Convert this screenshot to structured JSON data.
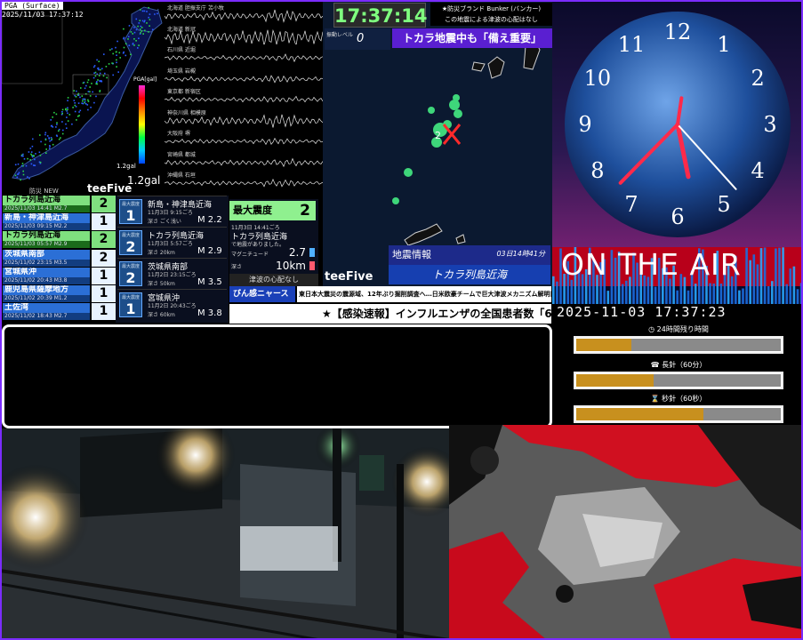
{
  "pga": {
    "header": "PGA (Surface)",
    "timestamp": "2025/11/03 17:37:12",
    "scale_label": "PGA[gal]",
    "gal_small": "1.2gal",
    "gal": "1.2gal",
    "new_label": "防災 NEW",
    "brand": "teeFive"
  },
  "waveforms": [
    {
      "label": "北海道 胆振支庁 苫小牧"
    },
    {
      "label": "北海道 新冠"
    },
    {
      "label": "石川県 近堀"
    },
    {
      "label": "埼玉県 岩槻"
    },
    {
      "label": "東京都 新宿区"
    },
    {
      "label": "神奈川県 相模原"
    },
    {
      "label": "大阪府 堺"
    },
    {
      "label": "宮崎県 都城"
    },
    {
      "label": "沖縄県 石垣"
    }
  ],
  "quakes": [
    {
      "place": "トカラ列島近海",
      "meta": "2025/11/03 14:41  M2.7",
      "intensity": "2"
    },
    {
      "place": "新島・神津島近海",
      "meta": "2025/11/03 09:15  M2.2",
      "intensity": "1"
    },
    {
      "place": "トカラ列島近海",
      "meta": "2025/11/03 05:57  M2.9",
      "intensity": "2"
    },
    {
      "place": "茨城県南部",
      "meta": "2025/11/02 23:15  M3.5",
      "intensity": "2"
    },
    {
      "place": "宮城県沖",
      "meta": "2025/11/02 20:43  M3.8",
      "intensity": "1"
    },
    {
      "place": "鹿児島県薩摩地方",
      "meta": "2025/11/02 20:39  M1.2",
      "intensity": "1"
    },
    {
      "place": "土佐湾",
      "meta": "2025/11/02 18:43  M2.7",
      "intensity": "1"
    }
  ],
  "details": [
    {
      "small": "最大震度",
      "int": "1",
      "place": "新島・神津島近海",
      "date": "11月3日 9:15ごろ",
      "depth": "深さ ごく浅い",
      "mag": "M 2.2"
    },
    {
      "small": "最大震度",
      "int": "2",
      "place": "トカラ列島近海",
      "date": "11月3日 5:57ごろ",
      "depth": "深さ 20km",
      "mag": "M 2.9"
    },
    {
      "small": "最大震度",
      "int": "2",
      "place": "茨城県南部",
      "date": "11月2日 23:15ごろ",
      "depth": "深さ 50km",
      "mag": "M 3.5"
    },
    {
      "small": "最大震度",
      "int": "1",
      "place": "宮城県沖",
      "date": "11月2日 20:43ごろ",
      "depth": "深さ 60km",
      "mag": "M 3.8"
    }
  ],
  "max_intensity": {
    "label": "最大震度",
    "value": "2",
    "time": "11月3日 14:41ごろ",
    "place": "トカラ列島近海",
    "line3": "で地震がありました。",
    "mag_label": "マグニチュード",
    "mag": "2.7",
    "depth_label": "深さ",
    "depth": "10km"
  },
  "tsunami": "津波の心配なし",
  "ticker1": {
    "label": "びん感ニャース",
    "text": "東日本大震災の震源域、12年ぶり掘削調査へ…日米欧豪チームで巨大津波メカニズム解明目指す"
  },
  "ticker2": "★【感染速報】インフルエンザの全国患者数「6.",
  "center_map": {
    "digital_clock": "17:37:14",
    "bunker_line1": "★防災ブランド Bunker (バンカー)",
    "bunker_line2": "この地震による津波の心配はなし",
    "shindo_label": "振動レベル",
    "shindo_value": "0",
    "headline": "トカラ地震中も「備え重要」",
    "info_title": "地震情報",
    "info_time": "03日14時41分",
    "info_place": "トカラ列島近海",
    "brand": "teeFive"
  },
  "analog_clock": {
    "hour_hand": 17,
    "minute_hand": 37,
    "second_hand": 23,
    "numerals": [
      "12",
      "1",
      "2",
      "3",
      "4",
      "5",
      "6",
      "7",
      "8",
      "9",
      "10",
      "11"
    ]
  },
  "on_air": "ON THE AIR",
  "datetime": "2025-11-03 17:37:23",
  "progress": [
    {
      "label": "24時間残り時間",
      "icon": "clock-icon",
      "glyph": "◷",
      "fill": 0.27
    },
    {
      "label": "長針（60分）",
      "icon": "phone-icon",
      "glyph": "☎",
      "fill": 0.38
    },
    {
      "label": "秒針（60秒）",
      "icon": "hourglass-icon",
      "glyph": "⌛",
      "fill": 0.62
    }
  ],
  "colors": {
    "accent_purple": "#5a1fd1",
    "onair_red": "#b8001a",
    "highlight_green": "#7fe07f",
    "digital_green": "#7fff7f"
  }
}
